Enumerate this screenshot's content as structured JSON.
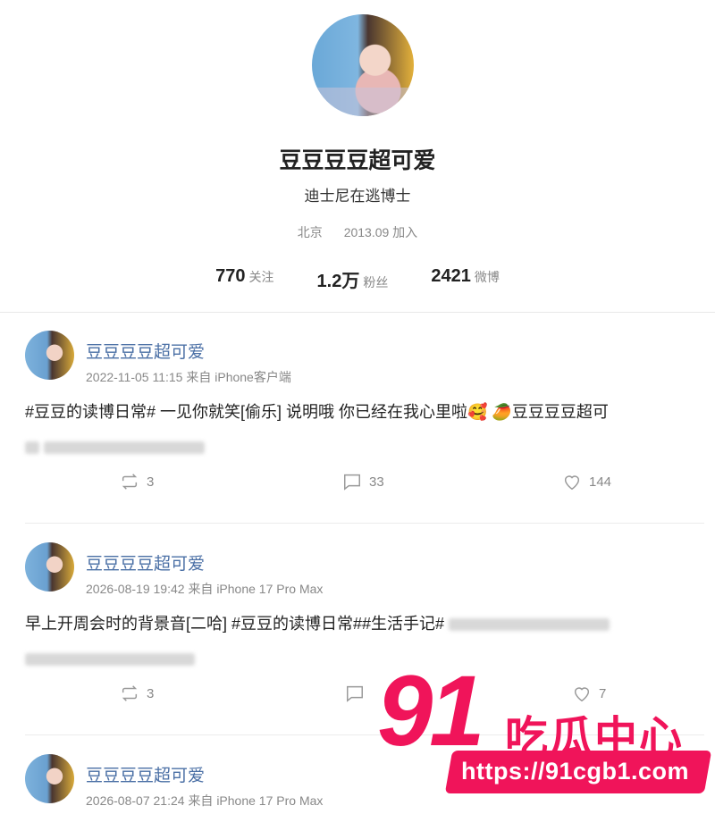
{
  "profile": {
    "name": "豆豆豆豆超可爱",
    "bio": "迪士尼在逃博士",
    "location": "北京",
    "joined": "2013.09 加入",
    "stats": [
      {
        "num": "770",
        "label": "关注"
      },
      {
        "num": "1.2万",
        "label": "粉丝"
      },
      {
        "num": "2421",
        "label": "微博"
      }
    ]
  },
  "posts": [
    {
      "author": "豆豆豆豆超可爱",
      "time": "2022-11-05 11:15",
      "source": "来自 iPhone客户端",
      "text": "#豆豆的读博日常# 一见你就笑[偷乐] 说明哦 你已经在我心里啦🥰 🥭豆豆豆豆超可",
      "reposts": "3",
      "comments": "33",
      "likes": "144"
    },
    {
      "author": "豆豆豆豆超可爱",
      "time": "2026-08-19 19:42",
      "source": "来自 iPhone 17 Pro Max",
      "text": "早上开周会时的背景音[二哈] #豆豆的读博日常##生活手记#",
      "reposts": "3",
      "comments": "",
      "likes": "7"
    },
    {
      "author": "豆豆豆豆超可爱",
      "time": "2026-08-07 21:24",
      "source": "来自 iPhone 17 Pro Max"
    }
  ],
  "watermark": {
    "number": "91",
    "brand": "吃瓜中心",
    "url": "https://91cgb1.com",
    "color": "#f0145a"
  },
  "icons": [
    "repost-icon",
    "comment-icon",
    "like-icon"
  ]
}
